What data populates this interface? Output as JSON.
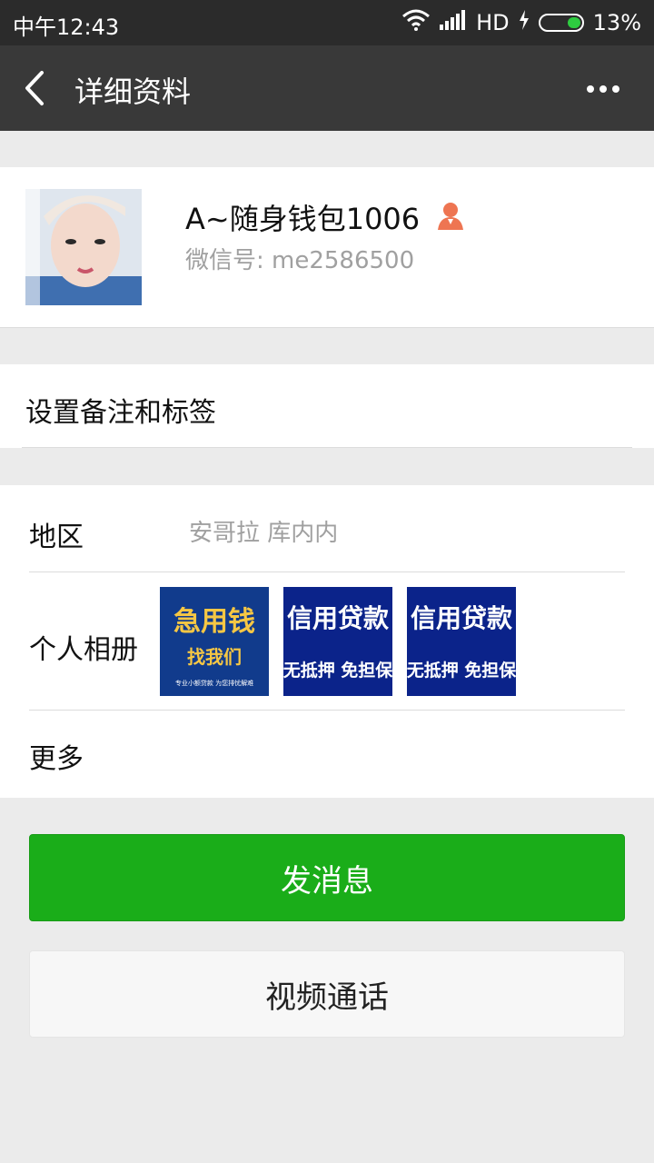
{
  "status_bar": {
    "time": "中午12:43",
    "network": "HD",
    "battery": "13%",
    "battery_level_percent": 13
  },
  "nav": {
    "title": "详细资料"
  },
  "profile": {
    "name": "A~随身钱包1006",
    "wechat_id": "微信号: me2586500"
  },
  "remark": {
    "label": "设置备注和标签"
  },
  "info": {
    "region_label": "地区",
    "region_value": "安哥拉  库内内",
    "album_label": "个人相册",
    "more_label": "更多"
  },
  "album_thumbs": [
    {
      "line1": "急用钱",
      "line2": "找我们",
      "line3": "专业小额贷款 为您排忧解难"
    },
    {
      "line1": "信用贷款",
      "line2": "无抵押 免担保"
    },
    {
      "line1": "信用贷款",
      "line2": "无抵押 免担保"
    }
  ],
  "buttons": {
    "send_message": "发消息",
    "video_call": "视频通话"
  },
  "colors": {
    "primary_green": "#1aad19",
    "navbar_bg": "#393939",
    "statusbar_bg": "#2b2b2b",
    "page_bg": "#ebebeb",
    "muted_text": "#a0a0a0",
    "gender_icon": "#ee7552"
  }
}
